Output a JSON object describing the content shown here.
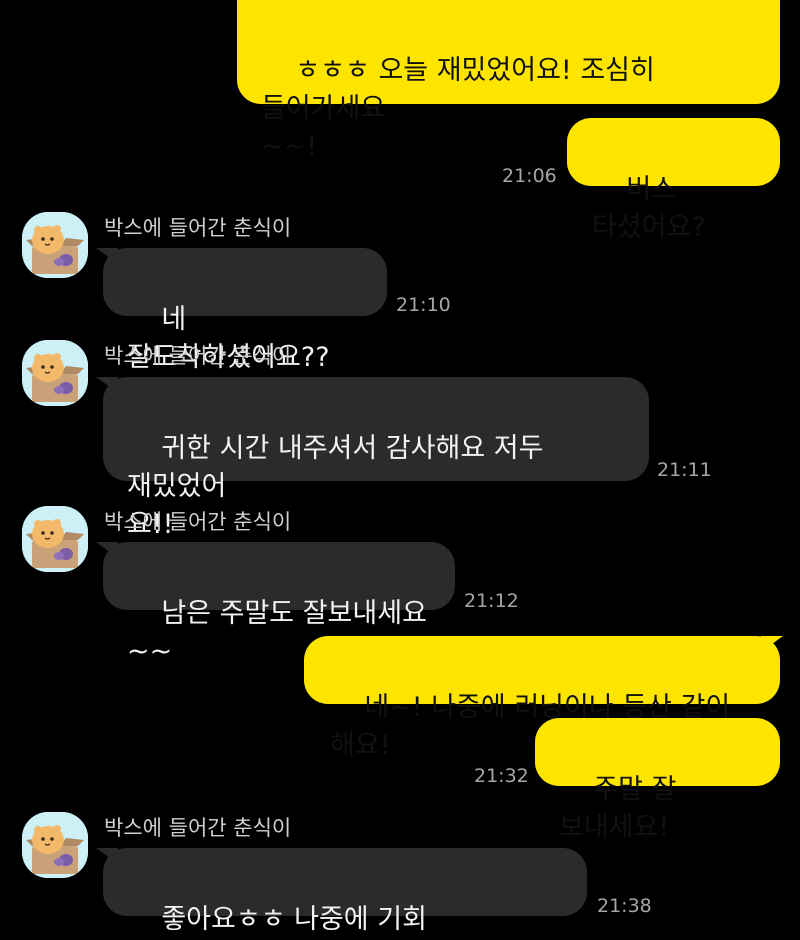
{
  "contact": {
    "name": "박스에 들어간 춘식이"
  },
  "messages": [
    {
      "from": "me",
      "text": "ㅎㅎㅎ 오늘 재밌었어요! 조심히 들어가세요\n~~!"
    },
    {
      "from": "me",
      "text": "버스 타셨어요?",
      "time": "21:06"
    },
    {
      "from": "other",
      "sender": "박스에 들어간 춘식이",
      "text": "네 잘도착하셨어요??",
      "time": "21:10"
    },
    {
      "from": "other",
      "sender": "박스에 들어간 춘식이",
      "text": "귀한 시간 내주셔서 감사해요 저두 재밌었어\n요!!",
      "time": "21:11"
    },
    {
      "from": "other",
      "sender": "박스에 들어간 춘식이",
      "text": "남은 주말도 잘보내세요~~",
      "time": "21:12"
    },
    {
      "from": "me",
      "text": "네~! 나중에 러닝이나 등산 같이 해요!"
    },
    {
      "from": "me",
      "text": "주말 잘 보내세요!",
      "time": "21:32"
    },
    {
      "from": "other",
      "sender": "박스에 들어간 춘식이",
      "text": "좋아요ㅎㅎ 나중에 기회 되면같이해요!",
      "time": "21:38"
    }
  ],
  "colors": {
    "background": "#000000",
    "my_bubble": "#FEE500",
    "their_bubble": "#2B2B2B",
    "timestamp": "#A6A6A6",
    "avatar_bg": "#CDEFF6"
  },
  "icons": {
    "avatar": "choonsik-in-box-avatar-icon"
  }
}
